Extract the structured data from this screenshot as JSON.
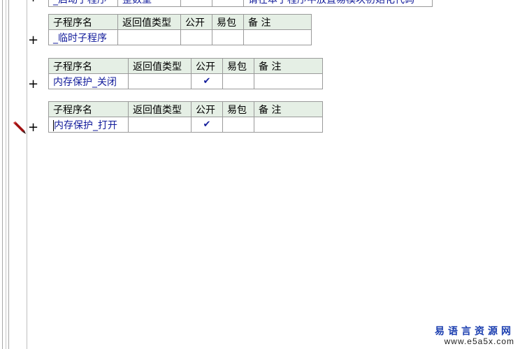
{
  "header_labels": {
    "name": "子程序名",
    "return_type": "返回值类型",
    "public": "公开",
    "easy_package": "易包",
    "remark": "备 注"
  },
  "top_partial_row": {
    "name": "_启动子程序",
    "return_type": "整数型",
    "remark": "请在本子程序中放置易模块初始化代码"
  },
  "subroutines": [
    {
      "name": "_临时子程序",
      "return_type": "",
      "public": false,
      "easy_package": false,
      "remark": ""
    },
    {
      "name": "内存保护_关闭",
      "return_type": "",
      "public": true,
      "easy_package": false,
      "remark": ""
    },
    {
      "name": "内存保护_打开",
      "return_type": "",
      "public": true,
      "easy_package": false,
      "remark": ""
    }
  ],
  "expand_symbol": "+",
  "check_symbol": "✔",
  "icons": {
    "expand": "plus-icon",
    "edit": "pencil-icon",
    "checked": "checkmark-icon"
  },
  "colors": {
    "header_bg": "#e5efe5",
    "name_text": "#101a9a",
    "check": "#9c1b1b",
    "remark_text": "#1e8a1e"
  },
  "watermark": {
    "line1": "易语言资源网",
    "line2": "www.e5a5x.com"
  }
}
